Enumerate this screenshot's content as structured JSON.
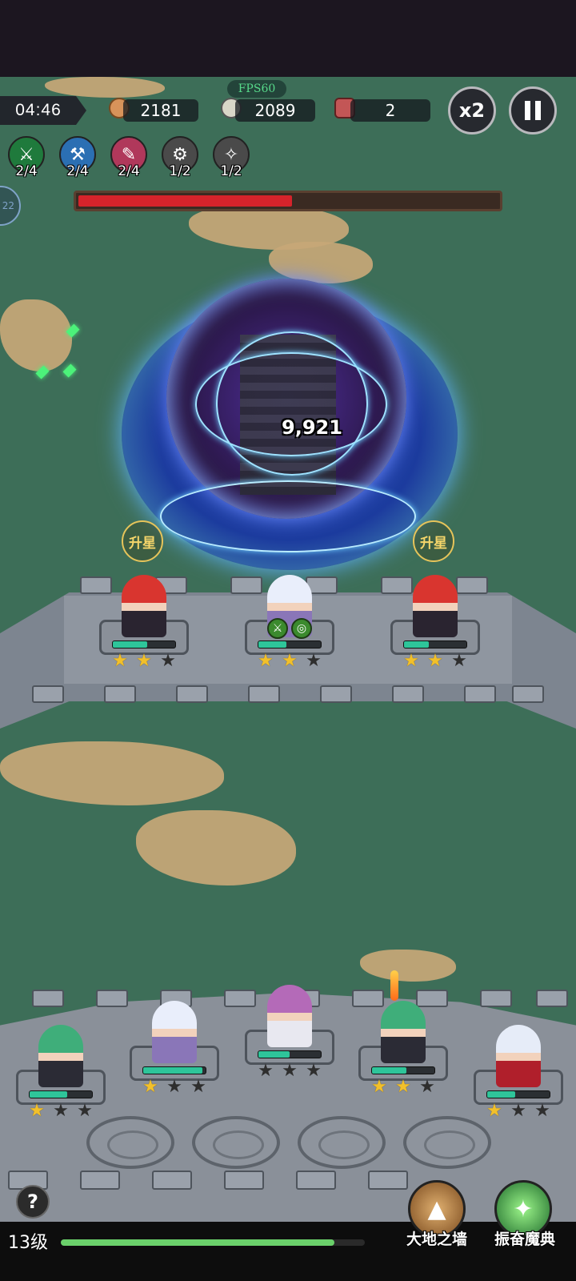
{
  "hud": {
    "timer": "04:46",
    "fps": "FPS60",
    "coins": "2181",
    "kills": "2089",
    "enemies": "2",
    "speed_label": "x2",
    "pause_icon": "pause-icon"
  },
  "skills": [
    {
      "icon": "sword-icon",
      "count": "2/4",
      "color": "#1f7a3c"
    },
    {
      "icon": "axe-icon",
      "count": "2/4",
      "color": "#2b6fb3"
    },
    {
      "icon": "blade-icon",
      "count": "2/4",
      "color": "#b0385b"
    },
    {
      "icon": "gear-icon",
      "count": "1/2",
      "color": "#4a4a4a"
    },
    {
      "icon": "wrench-icon",
      "count": "1/2",
      "color": "#4a4a4a"
    }
  ],
  "boss": {
    "health_fraction": 0.51,
    "damage_text": "9,921"
  },
  "star_up_label": "升星",
  "level": "13级",
  "xp_fraction": 0.9,
  "ultimates": [
    {
      "label": "大地之墙",
      "icon": "earth-wall-icon",
      "color": "#8a5a2a"
    },
    {
      "label": "振奋魔典",
      "icon": "grimoire-icon",
      "color": "#2e8a3a"
    }
  ],
  "side_tab_text": "22",
  "front_heroes": [
    {
      "name": "red-hair-swordswoman",
      "stars": 2,
      "hp": 0.55
    },
    {
      "name": "white-hair-mage",
      "stars": 2,
      "hp": 0.45
    },
    {
      "name": "red-hair-swordswoman",
      "stars": 2,
      "hp": 0.4
    }
  ],
  "back_heroes": [
    {
      "name": "green-hair-gunner",
      "stars": 1,
      "hp": 0.6
    },
    {
      "name": "white-hair-mage",
      "stars": 1,
      "hp": 0.95
    },
    {
      "name": "purple-hair-rogue",
      "stars": 0,
      "hp": 0.5
    },
    {
      "name": "green-hair-gunner",
      "stars": 2,
      "hp": 0.55
    },
    {
      "name": "silver-hair-witch",
      "stars": 1,
      "hp": 0.45
    }
  ]
}
